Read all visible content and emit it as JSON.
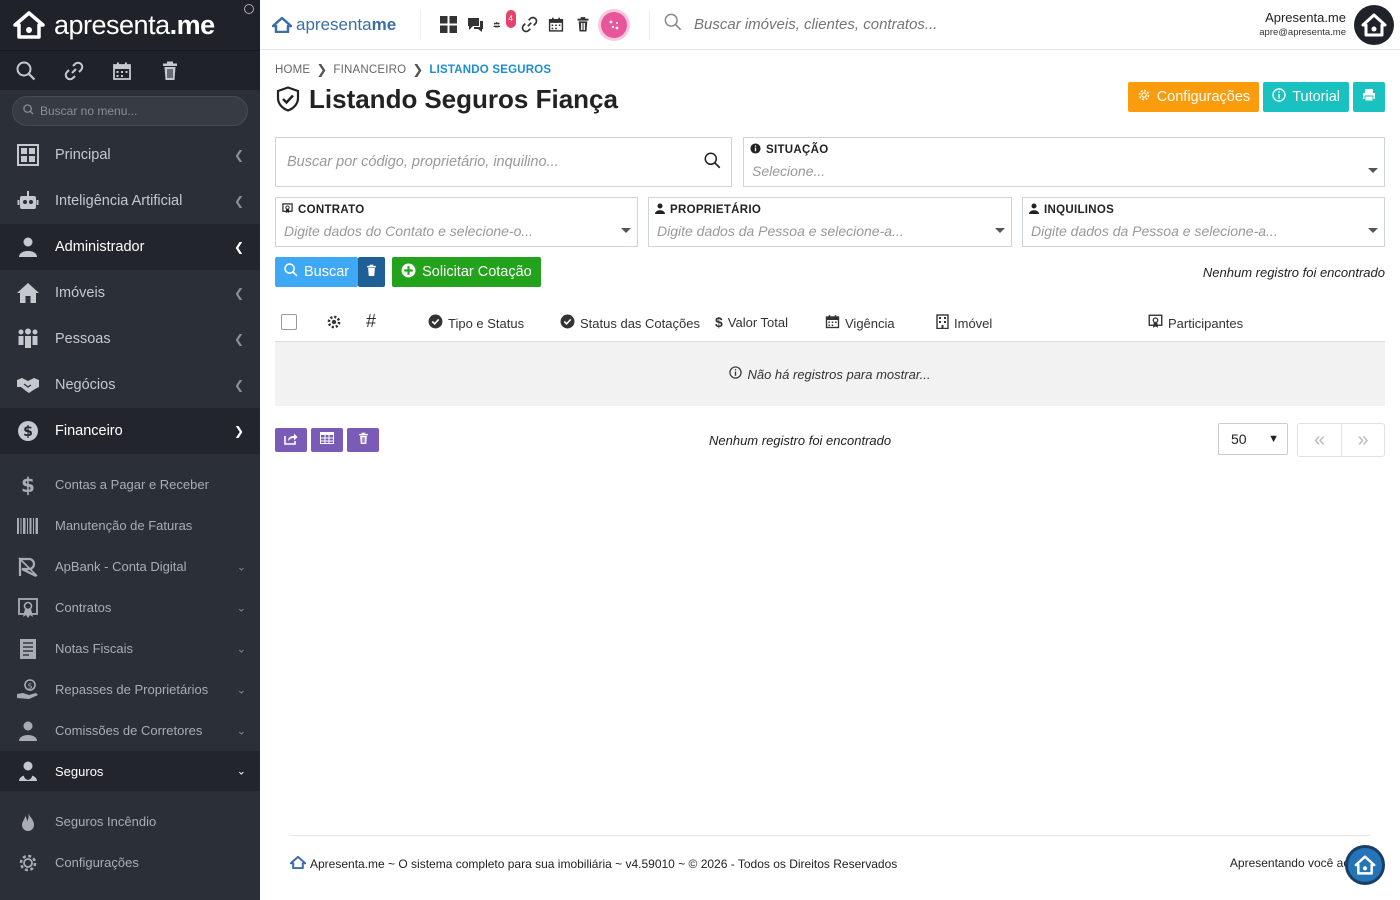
{
  "brand": {
    "name_light": "apresenta",
    "name_bold": ".me"
  },
  "sidebar": {
    "search_placeholder": "Buscar no menu...",
    "items": [
      {
        "label": "Principal"
      },
      {
        "label": "Inteligência Artificial"
      },
      {
        "label": "Administrador"
      },
      {
        "label": "Imóveis"
      },
      {
        "label": "Pessoas"
      },
      {
        "label": "Negócios"
      },
      {
        "label": "Financeiro"
      }
    ],
    "financeiro_sub": [
      {
        "label": "Contas a Pagar e Receber"
      },
      {
        "label": "Manutenção de Faturas"
      },
      {
        "label": "ApBank - Conta Digital"
      },
      {
        "label": "Contratos"
      },
      {
        "label": "Notas Fiscais"
      },
      {
        "label": "Repasses de Proprietários"
      },
      {
        "label": "Comissões de Corretores"
      },
      {
        "label": "Seguros"
      }
    ],
    "seguros_sub": [
      {
        "label": "Seguros Incêndio"
      },
      {
        "label": "Configurações"
      }
    ]
  },
  "topbar": {
    "logo_light": "apresenta",
    "logo_bold": "me",
    "notif_count": "4",
    "search_placeholder": "Buscar imóveis, clientes, contratos...",
    "user_name": "Apresenta.me",
    "user_email": "apre@apresenta.me"
  },
  "breadcrumb": {
    "home": "HOME",
    "section": "FINANCEIRO",
    "current": "LISTANDO SEGUROS"
  },
  "page": {
    "title_light": "Listando",
    "title_bold": "Seguros Fiança"
  },
  "actions": {
    "config": "Configurações",
    "tutorial": "Tutorial"
  },
  "filters": {
    "search_placeholder": "Buscar por código, proprietário, inquilino...",
    "situacao_label": "SITUAÇÃO",
    "situacao_placeholder": "Selecione...",
    "contrato_label": "CONTRATO",
    "contrato_placeholder": "Digite dados do Contato e selecione-o...",
    "proprietario_label": "PROPRIETÁRIO",
    "proprietario_placeholder": "Digite dados da Pessoa e selecione-a...",
    "inquilinos_label": "INQUILINOS",
    "inquilinos_placeholder": "Digite dados da Pessoa e selecione-a..."
  },
  "buttons": {
    "buscar": "Buscar",
    "solicitar": "Solicitar Cotação"
  },
  "no_records": "Nenhum registro foi encontrado",
  "table": {
    "columns": {
      "hash": "#",
      "tipo_status": "Tipo e Status",
      "status_cotacoes": "Status das Cotações",
      "valor_total": "Valor Total",
      "vigencia": "Vigência",
      "imovel": "Imóvel",
      "participantes": "Participantes"
    },
    "empty": "Não há registros para mostrar..."
  },
  "pagination": {
    "page_size": "50",
    "first": "«",
    "last": "»"
  },
  "footer": {
    "left": "Apresenta.me ~ O sistema completo para sua imobiliária ~ v4.59010 ~ © 2026 - Todos os Direitos Reservados",
    "right": "Apresentando você ao mu"
  }
}
